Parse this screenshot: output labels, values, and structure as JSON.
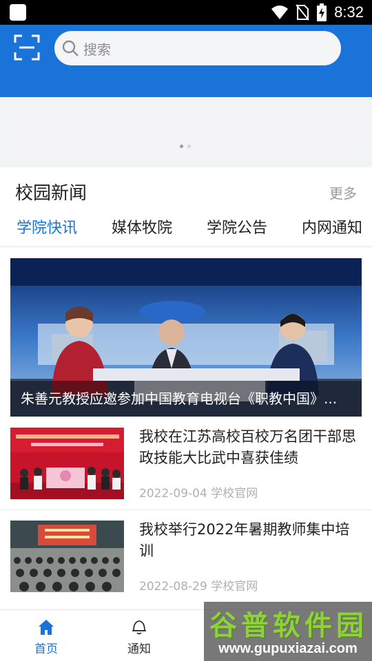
{
  "status_bar": {
    "time": "8:32"
  },
  "header": {
    "search_placeholder": "搜索"
  },
  "banner": {
    "dots": 2,
    "active_dot": 1
  },
  "news": {
    "title": "校园新闻",
    "more": "更多",
    "tabs": [
      {
        "label": "学院快讯",
        "active": true
      },
      {
        "label": "媒体牧院",
        "active": false
      },
      {
        "label": "学院公告",
        "active": false
      },
      {
        "label": "内网通知",
        "active": false
      }
    ],
    "hero": {
      "caption": "朱善元教授应邀参加中国教育电视台《职教中国》..."
    },
    "items": [
      {
        "title": "我校在江苏高校百校万名团干部思政技能大比武中喜获佳绩",
        "date": "2022-09-04",
        "source": "学校官网",
        "meta": "2022-09-04 学校官网"
      },
      {
        "title": "我校举行2022年暑期教师集中培训",
        "date": "2022-08-29",
        "source": "学校官网",
        "meta": "2022-08-29 学校官网"
      }
    ]
  },
  "bottom_nav": [
    {
      "label": "首页",
      "icon": "home-icon",
      "active": true
    },
    {
      "label": "通知",
      "icon": "bell-icon",
      "active": false
    }
  ],
  "watermark": {
    "top": "谷普软件园",
    "bottom": "www.gupuxiazai.com"
  },
  "colors": {
    "primary": "#1a73d8",
    "text": "#222222",
    "muted": "#b0b0b0"
  }
}
